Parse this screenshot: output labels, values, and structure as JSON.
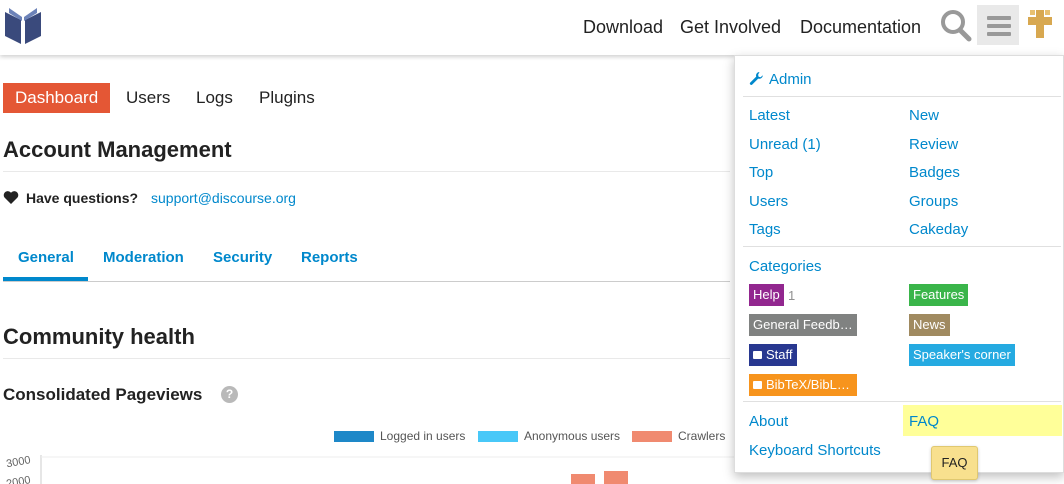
{
  "header": {
    "nav": [
      "Download",
      "Get Involved",
      "Documentation"
    ],
    "logo_icon": "discourse-book-logo",
    "search_icon": "search-icon",
    "menu_icon": "hamburger-icon",
    "avatar_icon": "user-avatar"
  },
  "admin_tabs": [
    "Dashboard",
    "Users",
    "Logs",
    "Plugins"
  ],
  "page": {
    "title": "Account Management",
    "questions_label": "Have questions?",
    "support_email": "support@discourse.org",
    "subtabs": [
      "General",
      "Moderation",
      "Security",
      "Reports"
    ],
    "section_title": "Community health",
    "report_title": "Consolidated Pageviews",
    "help_glyph": "?"
  },
  "chart_data": {
    "type": "bar",
    "title": "Consolidated Pageviews",
    "series": [
      {
        "name": "Logged in users",
        "color": "#1e88c8"
      },
      {
        "name": "Anonymous users",
        "color": "#48c8f8"
      },
      {
        "name": "Crawlers",
        "color": "#f08a70"
      }
    ],
    "y_ticks": [
      "3000",
      "2000"
    ],
    "ylim": [
      0,
      3000
    ]
  },
  "menu": {
    "admin_label": "Admin",
    "links_left": [
      "Latest",
      "Unread (1)",
      "Top",
      "Users",
      "Tags"
    ],
    "links_right": [
      "New",
      "Review",
      "Badges",
      "Groups",
      "Cakeday"
    ],
    "categories_label": "Categories",
    "categories": [
      {
        "name": "Help",
        "color": "#92278f",
        "count": "1",
        "locked": false
      },
      {
        "name": "Features",
        "color": "#3ab54a",
        "count": "",
        "locked": false
      },
      {
        "name": "General Feedb…",
        "color": "#808281",
        "count": "",
        "locked": false
      },
      {
        "name": "News",
        "color": "#a08a60",
        "count": "",
        "locked": false
      },
      {
        "name": "Staff",
        "color": "#283890",
        "count": "",
        "locked": true
      },
      {
        "name": "Speaker's corner",
        "color": "#25aae1",
        "count": "",
        "locked": false
      },
      {
        "name": "BibTeX/BibL…",
        "color": "#f7941d",
        "count": "",
        "locked": true
      }
    ],
    "about": "About",
    "faq": "FAQ",
    "keyboard_shortcuts": "Keyboard Shortcuts",
    "tooltip": "FAQ"
  }
}
